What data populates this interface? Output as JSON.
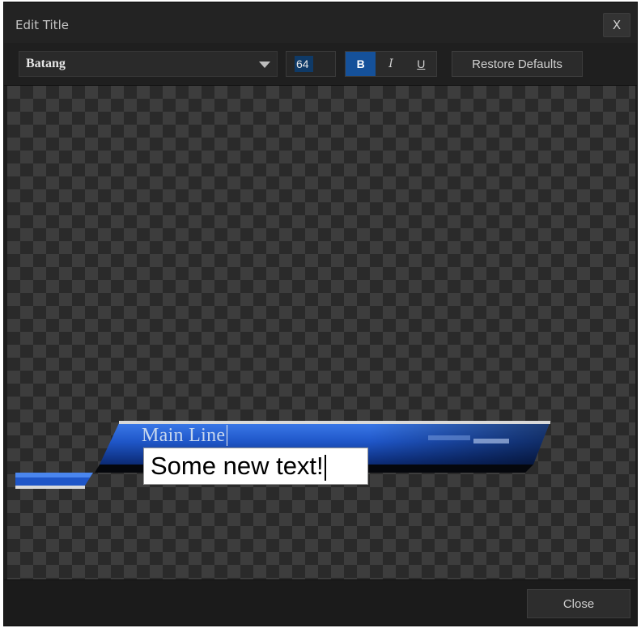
{
  "window": {
    "title": "Edit Title",
    "close_x_label": "X"
  },
  "toolbar": {
    "font_family": "Batang",
    "font_size": "64",
    "bold_label": "B",
    "italic_label": "I",
    "underline_label": "U",
    "bold_active": true,
    "restore_defaults_label": "Restore Defaults"
  },
  "preview": {
    "main_line_text": "Main Line",
    "edit_text_value": "Some new text!",
    "bar_color": "#1f56c8",
    "highlight_color": "#d9d9d9"
  },
  "footer": {
    "close_label": "Close"
  }
}
